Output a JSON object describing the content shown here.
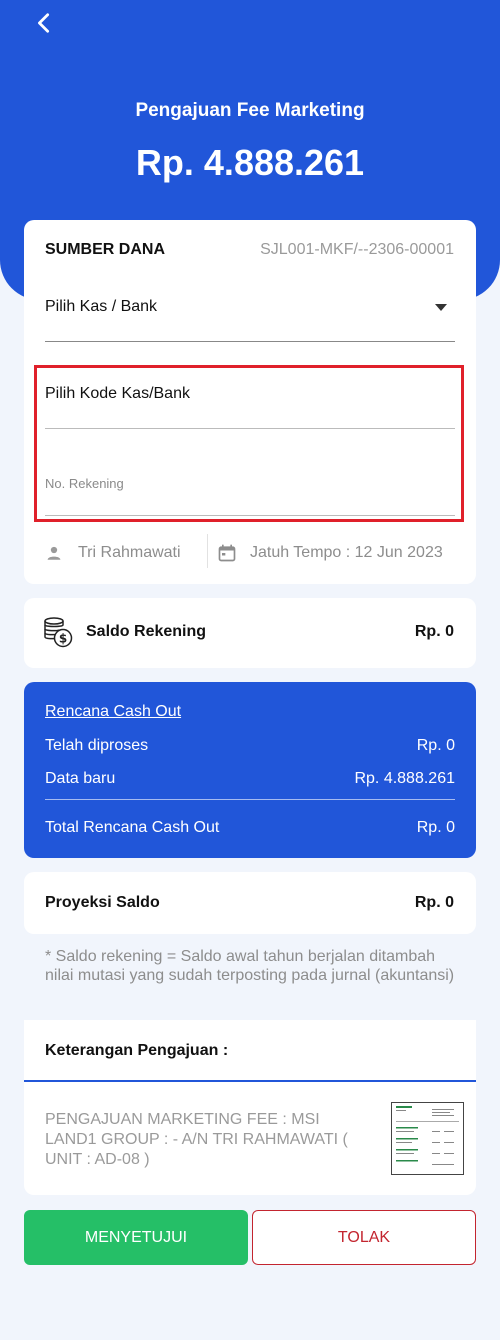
{
  "header": {
    "title": "Pengajuan Fee Marketing",
    "amount": "Rp. 4.888.261",
    "back_icon": "chevron-left-icon"
  },
  "sumber_dana": {
    "label": "SUMBER DANA",
    "code": "SJL001-MKF/--2306-00001",
    "kas_bank_select": "Pilih Kas / Bank",
    "kode_kas_bank": "Pilih Kode Kas/Bank",
    "no_rekening_placeholder": "No. Rekening",
    "user_name": "Tri Rahmawati",
    "jatuh_tempo": "Jatuh Tempo :  12 Jun 2023"
  },
  "saldo_rekening": {
    "label": "Saldo Rekening",
    "value": "Rp. 0"
  },
  "rencana_cash_out": {
    "title": "Rencana Cash Out",
    "rows": [
      {
        "label": "Telah diproses",
        "value": "Rp. 0"
      },
      {
        "label": "Data baru",
        "value": "Rp. 4.888.261"
      }
    ],
    "total_label": "Total Rencana Cash Out",
    "total_value": "Rp. 0"
  },
  "proyeksi_saldo": {
    "label": "Proyeksi Saldo",
    "value": "Rp. 0"
  },
  "note": "* Saldo rekening = Saldo awal tahun berjalan ditambah nilai mutasi yang sudah terposting pada jurnal (akuntansi)",
  "keterangan": {
    "label": "Keterangan Pengajuan :",
    "text": "PENGAJUAN MARKETING FEE : MSI LAND1 GROUP : - A/N TRI RAHMAWATI ( UNIT : AD-08 )"
  },
  "buttons": {
    "approve": "MENYETUJUI",
    "reject": "TOLAK"
  },
  "colors": {
    "primary": "#2156d9",
    "approve": "#25bf67",
    "reject": "#c3252f",
    "highlight": "#e0202a"
  }
}
